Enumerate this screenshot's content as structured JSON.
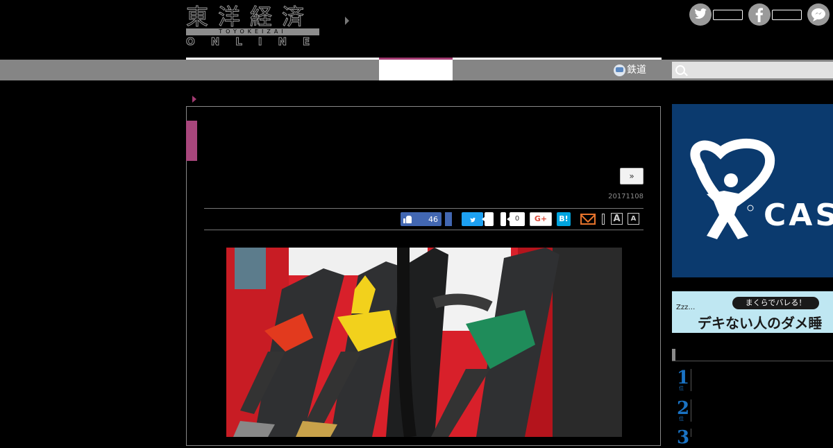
{
  "header": {
    "logo_main": "東洋経済",
    "logo_romaji": "TOYOKEIZAI",
    "logo_sub": "ONLINE"
  },
  "social": {
    "twitter_icon": "twitter-icon",
    "facebook_icon": "facebook-icon",
    "chat_icon": "chat-bubble-icon"
  },
  "nav": {
    "railway_label": "鉄道"
  },
  "search": {
    "placeholder": ""
  },
  "article": {
    "next_label": "»",
    "date": "20171108"
  },
  "share": {
    "like_count": "46",
    "pocket_count": "0",
    "gplus_label": "G+",
    "hatena_label": "B!",
    "font_large": "A",
    "font_small": "A"
  },
  "sidebar": {
    "cas_text": "CAS",
    "sleep_pill": "まくらでバレる！",
    "sleep_main": "デキない人のダメ睡",
    "sleep_zzz": "Zzz…",
    "ranking": [
      {
        "num": "1",
        "sub": "位"
      },
      {
        "num": "2",
        "sub": "位"
      },
      {
        "num": "3",
        "sub": "位"
      }
    ]
  },
  "colors": {
    "accent": "#a33b72",
    "nav_bg": "#858585",
    "facebook": "#4267b2",
    "twitter": "#1da1f2",
    "hatena": "#00a4de",
    "ad_blue": "#0b3a6e",
    "rank_blue": "#1a73c4"
  }
}
